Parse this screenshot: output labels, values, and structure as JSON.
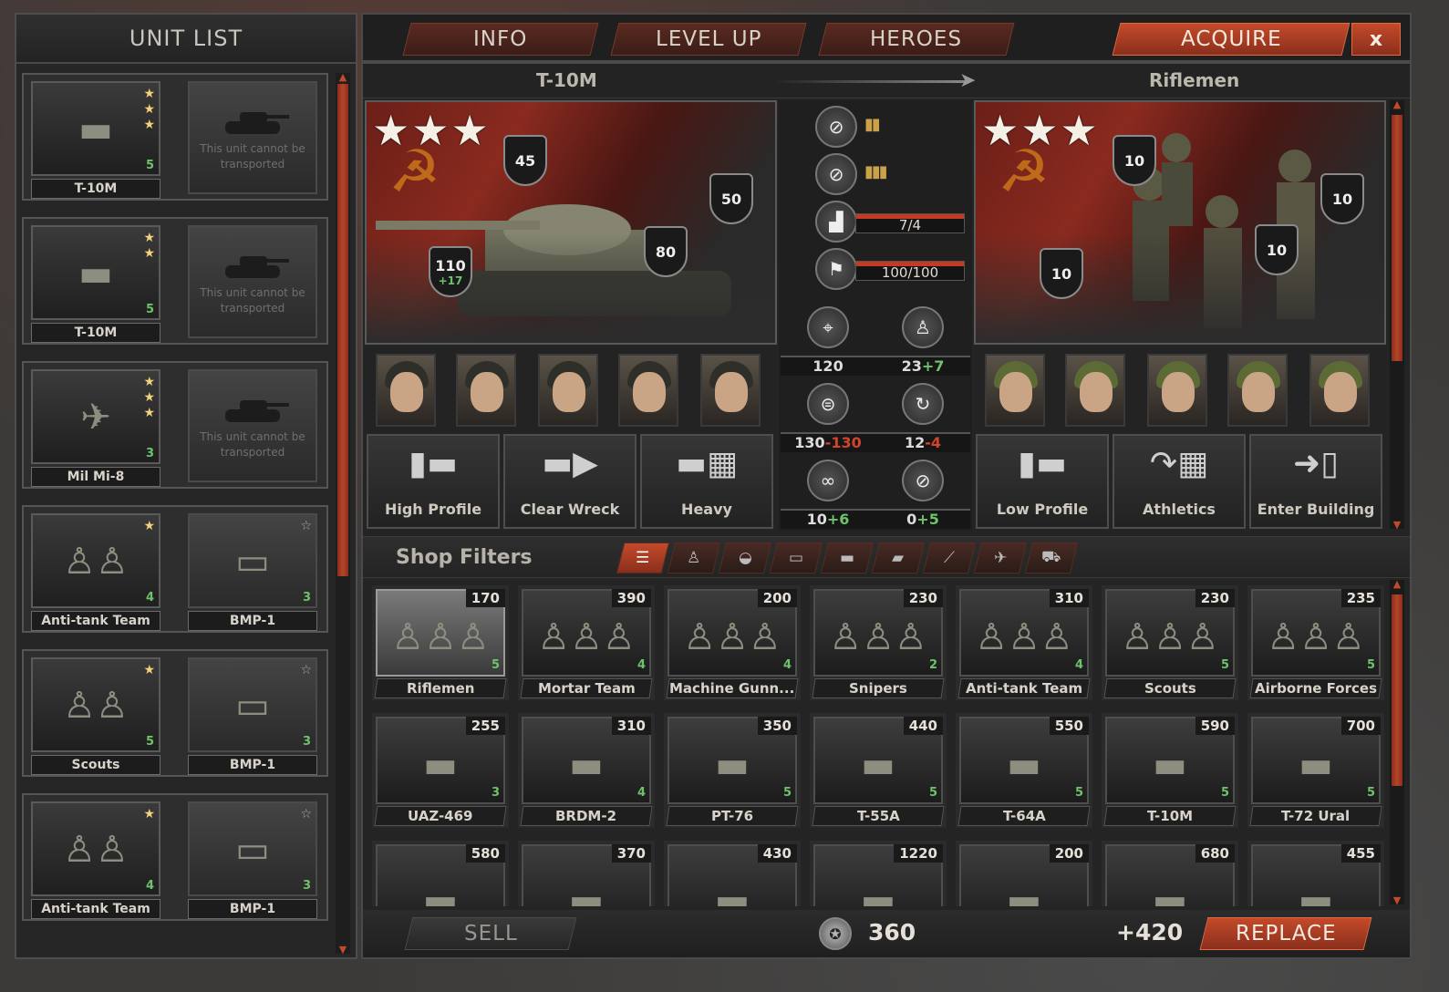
{
  "left_panel": {
    "title": "UNIT LIST",
    "no_transport_text": "This unit cannot be transported",
    "rows": [
      {
        "unit": "T-10M",
        "stars": 3,
        "level": "5",
        "transport": "",
        "transport_level": ""
      },
      {
        "unit": "T-10M",
        "stars": 2,
        "level": "5",
        "transport": "",
        "transport_level": ""
      },
      {
        "unit": "Mil Mi-8",
        "stars": 3,
        "level": "3",
        "transport": "",
        "transport_level": ""
      },
      {
        "unit": "Anti-tank Team",
        "stars": 1,
        "level": "4",
        "transport": "BMP-1",
        "transport_level": "3"
      },
      {
        "unit": "Scouts",
        "stars": 1,
        "level": "5",
        "transport": "BMP-1",
        "transport_level": "3"
      },
      {
        "unit": "Anti-tank Team",
        "stars": 1,
        "level": "4",
        "transport": "BMP-1",
        "transport_level": "3"
      }
    ]
  },
  "tabs": {
    "info": "INFO",
    "level_up": "LEVEL UP",
    "heroes": "HEROES",
    "acquire": "ACQUIRE",
    "close": "x"
  },
  "compare": {
    "current": "T-10M",
    "target": "Riflemen"
  },
  "current_unit": {
    "shields": {
      "top": "45",
      "right": "50",
      "mid": "80",
      "front": "110",
      "front_bonus": "+17"
    },
    "traits": [
      "High Profile",
      "Clear Wreck",
      "Heavy"
    ]
  },
  "target_unit": {
    "shields": {
      "top": "10",
      "right": "10",
      "mid": "10",
      "front": "10"
    },
    "traits": [
      "Low Profile",
      "Athletics",
      "Enter Building"
    ]
  },
  "stats": {
    "speed": "7/4",
    "morale": "100/100",
    "accuracy": "120",
    "infantry_dmg_base": "23",
    "infantry_dmg_bonus": "+7",
    "armor_pen_base": "130",
    "armor_pen_mod": "-130",
    "reload_base": "12",
    "reload_mod": "-4",
    "sight_base": "10",
    "sight_bonus": "+6",
    "stealth_base": "0",
    "stealth_bonus": "+5"
  },
  "shop": {
    "title": "Shop Filters",
    "items": [
      {
        "name": "Riflemen",
        "price": "170",
        "level": "5"
      },
      {
        "name": "Mortar Team",
        "price": "390",
        "level": "4"
      },
      {
        "name": "Machine Gunn...",
        "price": "200",
        "level": "4"
      },
      {
        "name": "Snipers",
        "price": "230",
        "level": "2"
      },
      {
        "name": "Anti-tank Team",
        "price": "310",
        "level": "4"
      },
      {
        "name": "Scouts",
        "price": "230",
        "level": "5"
      },
      {
        "name": "Airborne Forces",
        "price": "235",
        "level": "5"
      },
      {
        "name": "UAZ-469",
        "price": "255",
        "level": "3"
      },
      {
        "name": "BRDM-2",
        "price": "310",
        "level": "4"
      },
      {
        "name": "PT-76",
        "price": "350",
        "level": "5"
      },
      {
        "name": "T-55A",
        "price": "440",
        "level": "5"
      },
      {
        "name": "T-64A",
        "price": "550",
        "level": "5"
      },
      {
        "name": "T-10M",
        "price": "590",
        "level": "5"
      },
      {
        "name": "T-72 Ural",
        "price": "700",
        "level": "5"
      },
      {
        "name": "",
        "price": "580",
        "level": ""
      },
      {
        "name": "",
        "price": "370",
        "level": ""
      },
      {
        "name": "",
        "price": "430",
        "level": ""
      },
      {
        "name": "",
        "price": "1220",
        "level": ""
      },
      {
        "name": "",
        "price": "200",
        "level": ""
      },
      {
        "name": "",
        "price": "680",
        "level": ""
      },
      {
        "name": "",
        "price": "455",
        "level": ""
      }
    ]
  },
  "bottom": {
    "sell": "SELL",
    "money": "360",
    "gain": "+420",
    "replace": "REPLACE"
  },
  "colors": {
    "accent": "#c44a2a",
    "bonus_green": "#6ec36a",
    "penalty_red": "#d2452c",
    "star_gold": "#f3d27a"
  }
}
